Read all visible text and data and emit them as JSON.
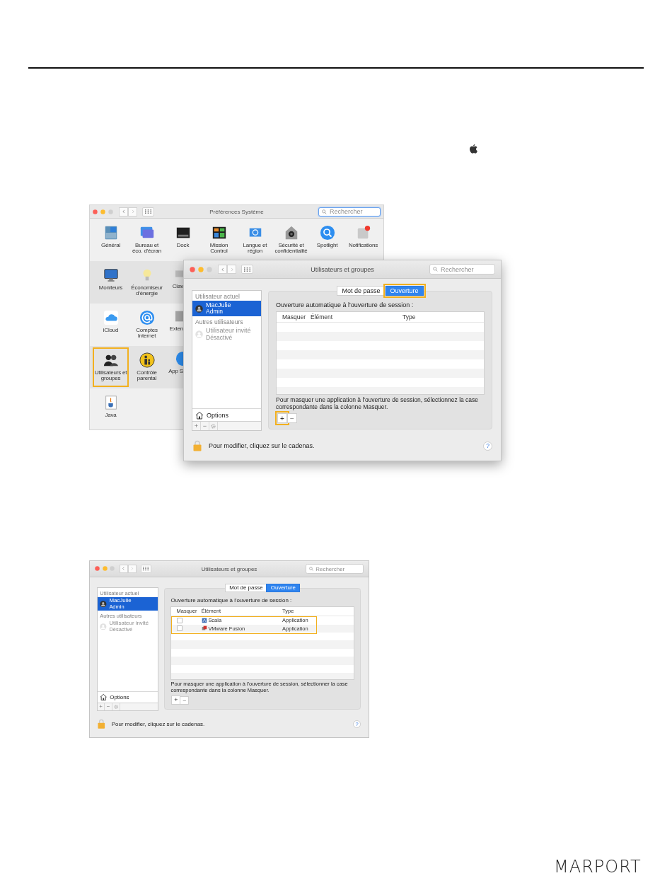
{
  "screenshot_1": {
    "preferences_window": {
      "title": "Préférences Système",
      "search": {
        "placeholder": "Rechercher",
        "focused": true
      },
      "rows": [
        [
          {
            "label": "Général",
            "kind": "full",
            "highlighted": false
          },
          {
            "label": "Bureau et\néco. d'écran",
            "kind": "full",
            "highlighted": false
          },
          {
            "label": "Dock",
            "kind": "full",
            "highlighted": false
          },
          {
            "label": "Mission\nControl",
            "kind": "full",
            "highlighted": false
          },
          {
            "label": "Langue et\nrégion",
            "kind": "full",
            "highlighted": false
          },
          {
            "label": "Sécurité et\nconfidentialité",
            "kind": "full",
            "highlighted": false
          },
          {
            "label": "Spotlight",
            "kind": "full",
            "highlighted": false
          },
          {
            "label": "Notifications",
            "kind": "full",
            "highlighted": false
          }
        ],
        [
          {
            "label": "Moniteurs",
            "kind": "full",
            "highlighted": false
          },
          {
            "label": "Économiseur\nd'énergie",
            "kind": "full",
            "highlighted": false
          },
          {
            "label": "Clav",
            "kind": "partial"
          }
        ],
        [
          {
            "label": "iCloud",
            "kind": "full",
            "highlighted": false
          },
          {
            "label": "Comptes\nInternet",
            "kind": "full",
            "highlighted": false
          },
          {
            "label": "Exten",
            "kind": "partial"
          }
        ],
        [
          {
            "label": "Utilisateurs et\ngroupes",
            "kind": "full",
            "highlighted": true
          },
          {
            "label": "Contrôle\nparental",
            "kind": "full",
            "highlighted": false
          },
          {
            "label": "App S",
            "kind": "partial"
          }
        ],
        [
          {
            "label": "Java",
            "kind": "full",
            "highlighted": false
          }
        ]
      ]
    },
    "users_window": {
      "title": "Utilisateurs et groupes",
      "search": {
        "placeholder": "Rechercher"
      },
      "sidebar": {
        "sections": [
          {
            "header": "Utilisateur actuel",
            "users": [
              {
                "name": "MacJulie",
                "role": "Admin",
                "selected": true,
                "disabled": false
              }
            ]
          },
          {
            "header": "Autres utilisateurs",
            "users": [
              {
                "name": "Utilisateur invité",
                "role": "Désactivé",
                "selected": false,
                "disabled": true
              }
            ]
          }
        ],
        "options": "Options",
        "buttons": [
          "+",
          "−"
        ]
      },
      "tabs": [
        {
          "label": "Mot de passe",
          "selected": false,
          "highlighted": false
        },
        {
          "label": "Ouverture",
          "selected": true,
          "highlighted": true
        }
      ],
      "heading": "Ouverture automatique à l'ouverture de session :",
      "table": {
        "columns": [
          "Masquer",
          "Élément",
          "Type"
        ]
      },
      "note": "Pour masquer une application à l'ouverture de session, sélectionnez la case correspondante dans la colonne Masquer.",
      "add_button": {
        "label": "+",
        "highlighted": true
      },
      "remove_button": {
        "label": "−"
      },
      "footer": "Pour modifier, cliquez sur le cadenas.",
      "help": "?"
    }
  },
  "screenshot_2": {
    "users_window": {
      "title": "Utilisateurs et groupes",
      "search": {
        "placeholder": "Rechercher"
      },
      "sidebar": {
        "sections": [
          {
            "header": "Utilisateur actuel",
            "users": [
              {
                "name": "MacJulie",
                "role": "Admin",
                "selected": true,
                "disabled": false
              }
            ]
          },
          {
            "header": "Autres utilisateurs",
            "users": [
              {
                "name": "Utilisateur invité",
                "role": "Désactivé",
                "selected": false,
                "disabled": true
              }
            ]
          }
        ],
        "options": "Options",
        "buttons": [
          "+",
          "−"
        ]
      },
      "tabs": [
        {
          "label": "Mot de passe",
          "selected": false,
          "highlighted": false
        },
        {
          "label": "Ouverture",
          "selected": true,
          "highlighted": false
        }
      ],
      "heading": "Ouverture automatique à l'ouverture de session :",
      "table": {
        "columns": [
          "Masquer",
          "Élément",
          "Type"
        ],
        "rows": [
          {
            "checked": false,
            "name": "Scala",
            "type": "Application"
          },
          {
            "checked": false,
            "name": "VMware Fusion",
            "type": "Application"
          }
        ],
        "rows_highlighted": true
      },
      "note": "Pour masquer une application à l'ouverture de session, sélectionner la case correspondante dans la colonne Masquer.",
      "add_button": {
        "label": "+",
        "highlighted": false
      },
      "remove_button": {
        "label": "−"
      },
      "footer": "Pour modifier, cliquez sur le cadenas.",
      "help": "?"
    }
  },
  "logo": {
    "text": "MARPORT"
  }
}
